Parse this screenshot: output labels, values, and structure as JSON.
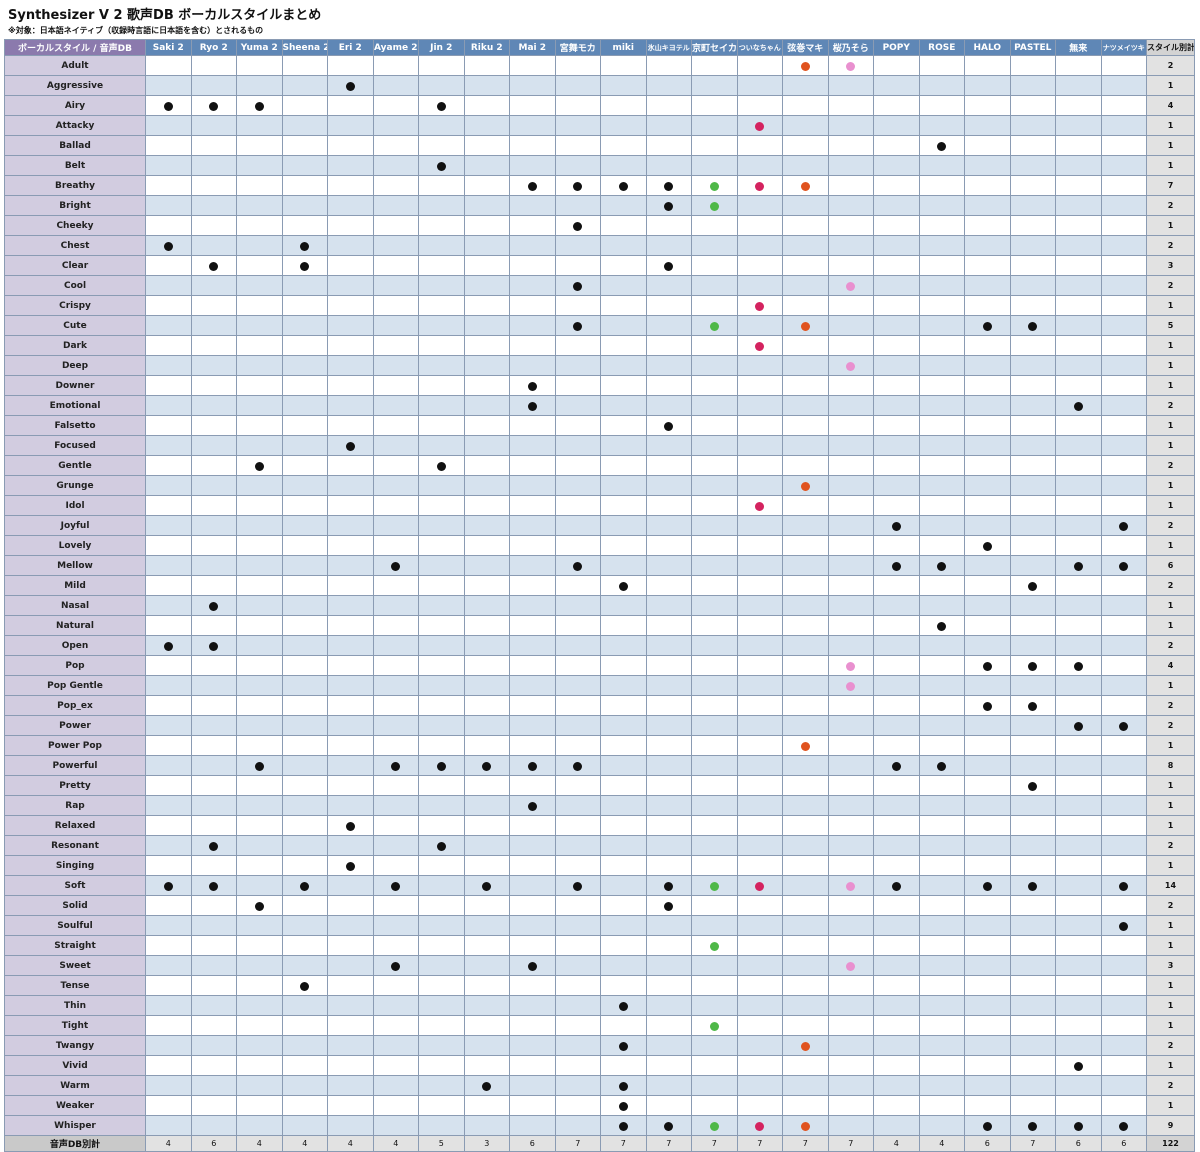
{
  "title": "Synthesizer V 2 歌声DB ボーカルスタイルまとめ",
  "subtitle": "※対象：日本語ネイティブ（収録時言語に日本語を含む）とされるもの",
  "header": {
    "corner": "ボーカルスタイル / 音声DB",
    "total": "スタイル別計",
    "footer_label": "音声DB別計",
    "grand_total": "122"
  },
  "colors": {
    "black": "#111111",
    "green": "#4fb848",
    "magenta": "#d4235f",
    "orange": "#e0531f",
    "pink": "#e990cf"
  },
  "voicebanks": [
    {
      "name": "Saki 2",
      "count": "4",
      "color": "black"
    },
    {
      "name": "Ryo 2",
      "count": "6",
      "color": "black"
    },
    {
      "name": "Yuma 2",
      "count": "4",
      "color": "black"
    },
    {
      "name": "Sheena 2",
      "count": "4",
      "color": "black"
    },
    {
      "name": "Eri 2",
      "count": "4",
      "color": "black"
    },
    {
      "name": "Ayame 2",
      "count": "4",
      "color": "black"
    },
    {
      "name": "Jin 2",
      "count": "5",
      "color": "black"
    },
    {
      "name": "Riku 2",
      "count": "3",
      "color": "black"
    },
    {
      "name": "Mai 2",
      "count": "6",
      "color": "black"
    },
    {
      "name": "宮舞モカ",
      "count": "7",
      "color": "black"
    },
    {
      "name": "miki",
      "count": "7",
      "color": "black"
    },
    {
      "name": "氷山キヨテル",
      "count": "7",
      "color": "black",
      "small": true
    },
    {
      "name": "京町セイカ",
      "count": "7",
      "color": "green"
    },
    {
      "name": "ついなちゃん",
      "count": "7",
      "color": "magenta",
      "small": true
    },
    {
      "name": "弦巻マキ",
      "count": "7",
      "color": "orange"
    },
    {
      "name": "桜乃そら",
      "count": "7",
      "color": "pink"
    },
    {
      "name": "POPY",
      "count": "4",
      "color": "black"
    },
    {
      "name": "ROSE",
      "count": "4",
      "color": "black"
    },
    {
      "name": "HALO",
      "count": "6",
      "color": "black"
    },
    {
      "name": "PASTEL",
      "count": "7",
      "color": "black"
    },
    {
      "name": "無来",
      "count": "6",
      "color": "black"
    },
    {
      "name": "ナツメイツキ",
      "count": "6",
      "color": "black",
      "small": true
    }
  ],
  "styles": [
    {
      "name": "Adult",
      "total": "2",
      "marks": [
        14,
        15
      ]
    },
    {
      "name": "Aggressive",
      "total": "1",
      "marks": [
        4
      ]
    },
    {
      "name": "Airy",
      "total": "4",
      "marks": [
        0,
        1,
        2,
        6
      ]
    },
    {
      "name": "Attacky",
      "total": "1",
      "marks": [
        13
      ]
    },
    {
      "name": "Ballad",
      "total": "1",
      "marks": [
        17
      ]
    },
    {
      "name": "Belt",
      "total": "1",
      "marks": [
        6
      ]
    },
    {
      "name": "Breathy",
      "total": "7",
      "marks": [
        8,
        9,
        10,
        11,
        12,
        13,
        14
      ]
    },
    {
      "name": "Bright",
      "total": "2",
      "marks": [
        11,
        12
      ]
    },
    {
      "name": "Cheeky",
      "total": "1",
      "marks": [
        9
      ]
    },
    {
      "name": "Chest",
      "total": "2",
      "marks": [
        0,
        3
      ]
    },
    {
      "name": "Clear",
      "total": "3",
      "marks": [
        1,
        3,
        11
      ]
    },
    {
      "name": "Cool",
      "total": "2",
      "marks": [
        9,
        15
      ]
    },
    {
      "name": "Crispy",
      "total": "1",
      "marks": [
        13
      ]
    },
    {
      "name": "Cute",
      "total": "5",
      "marks": [
        9,
        12,
        14,
        18,
        19
      ]
    },
    {
      "name": "Dark",
      "total": "1",
      "marks": [
        13
      ]
    },
    {
      "name": "Deep",
      "total": "1",
      "marks": [
        15
      ]
    },
    {
      "name": "Downer",
      "total": "1",
      "marks": [
        8
      ]
    },
    {
      "name": "Emotional",
      "total": "2",
      "marks": [
        8,
        20
      ]
    },
    {
      "name": "Falsetto",
      "total": "1",
      "marks": [
        11
      ]
    },
    {
      "name": "Focused",
      "total": "1",
      "marks": [
        4
      ]
    },
    {
      "name": "Gentle",
      "total": "2",
      "marks": [
        2,
        6
      ]
    },
    {
      "name": "Grunge",
      "total": "1",
      "marks": [
        14
      ]
    },
    {
      "name": "Idol",
      "total": "1",
      "marks": [
        13
      ]
    },
    {
      "name": "Joyful",
      "total": "2",
      "marks": [
        16,
        21
      ]
    },
    {
      "name": "Lovely",
      "total": "1",
      "marks": [
        18
      ]
    },
    {
      "name": "Mellow",
      "total": "6",
      "marks": [
        5,
        9,
        16,
        17,
        20,
        21
      ]
    },
    {
      "name": "Mild",
      "total": "2",
      "marks": [
        10,
        19
      ]
    },
    {
      "name": "Nasal",
      "total": "1",
      "marks": [
        1
      ]
    },
    {
      "name": "Natural",
      "total": "1",
      "marks": [
        17
      ]
    },
    {
      "name": "Open",
      "total": "2",
      "marks": [
        0,
        1
      ]
    },
    {
      "name": "Pop",
      "total": "4",
      "marks": [
        15,
        18,
        19,
        20
      ]
    },
    {
      "name": "Pop Gentle",
      "total": "1",
      "marks": [
        15
      ]
    },
    {
      "name": "Pop_ex",
      "total": "2",
      "marks": [
        18,
        19
      ]
    },
    {
      "name": "Power",
      "total": "2",
      "marks": [
        20,
        21
      ]
    },
    {
      "name": "Power Pop",
      "total": "1",
      "marks": [
        14
      ]
    },
    {
      "name": "Powerful",
      "total": "8",
      "marks": [
        2,
        5,
        6,
        7,
        8,
        9,
        16,
        17
      ]
    },
    {
      "name": "Pretty",
      "total": "1",
      "marks": [
        19
      ]
    },
    {
      "name": "Rap",
      "total": "1",
      "marks": [
        8
      ]
    },
    {
      "name": "Relaxed",
      "total": "1",
      "marks": [
        4
      ]
    },
    {
      "name": "Resonant",
      "total": "2",
      "marks": [
        1,
        6
      ]
    },
    {
      "name": "Singing",
      "total": "1",
      "marks": [
        4
      ]
    },
    {
      "name": "Soft",
      "total": "14",
      "marks": [
        0,
        1,
        3,
        5,
        7,
        9,
        11,
        12,
        13,
        15,
        16,
        18,
        19,
        21
      ]
    },
    {
      "name": "Solid",
      "total": "2",
      "marks": [
        2,
        11
      ]
    },
    {
      "name": "Soulful",
      "total": "1",
      "marks": [
        21
      ]
    },
    {
      "name": "Straight",
      "total": "1",
      "marks": [
        12
      ]
    },
    {
      "name": "Sweet",
      "total": "3",
      "marks": [
        5,
        8,
        15
      ]
    },
    {
      "name": "Tense",
      "total": "1",
      "marks": [
        3
      ]
    },
    {
      "name": "Thin",
      "total": "1",
      "marks": [
        10
      ]
    },
    {
      "name": "Tight",
      "total": "1",
      "marks": [
        12
      ]
    },
    {
      "name": "Twangy",
      "total": "2",
      "marks": [
        10,
        14
      ]
    },
    {
      "name": "Vivid",
      "total": "1",
      "marks": [
        20
      ]
    },
    {
      "name": "Warm",
      "total": "2",
      "marks": [
        7,
        10
      ]
    },
    {
      "name": "Weaker",
      "total": "1",
      "marks": [
        10
      ]
    },
    {
      "name": "Whisper",
      "total": "9",
      "marks": [
        10,
        11,
        12,
        13,
        14,
        18,
        19,
        20,
        21
      ]
    }
  ]
}
